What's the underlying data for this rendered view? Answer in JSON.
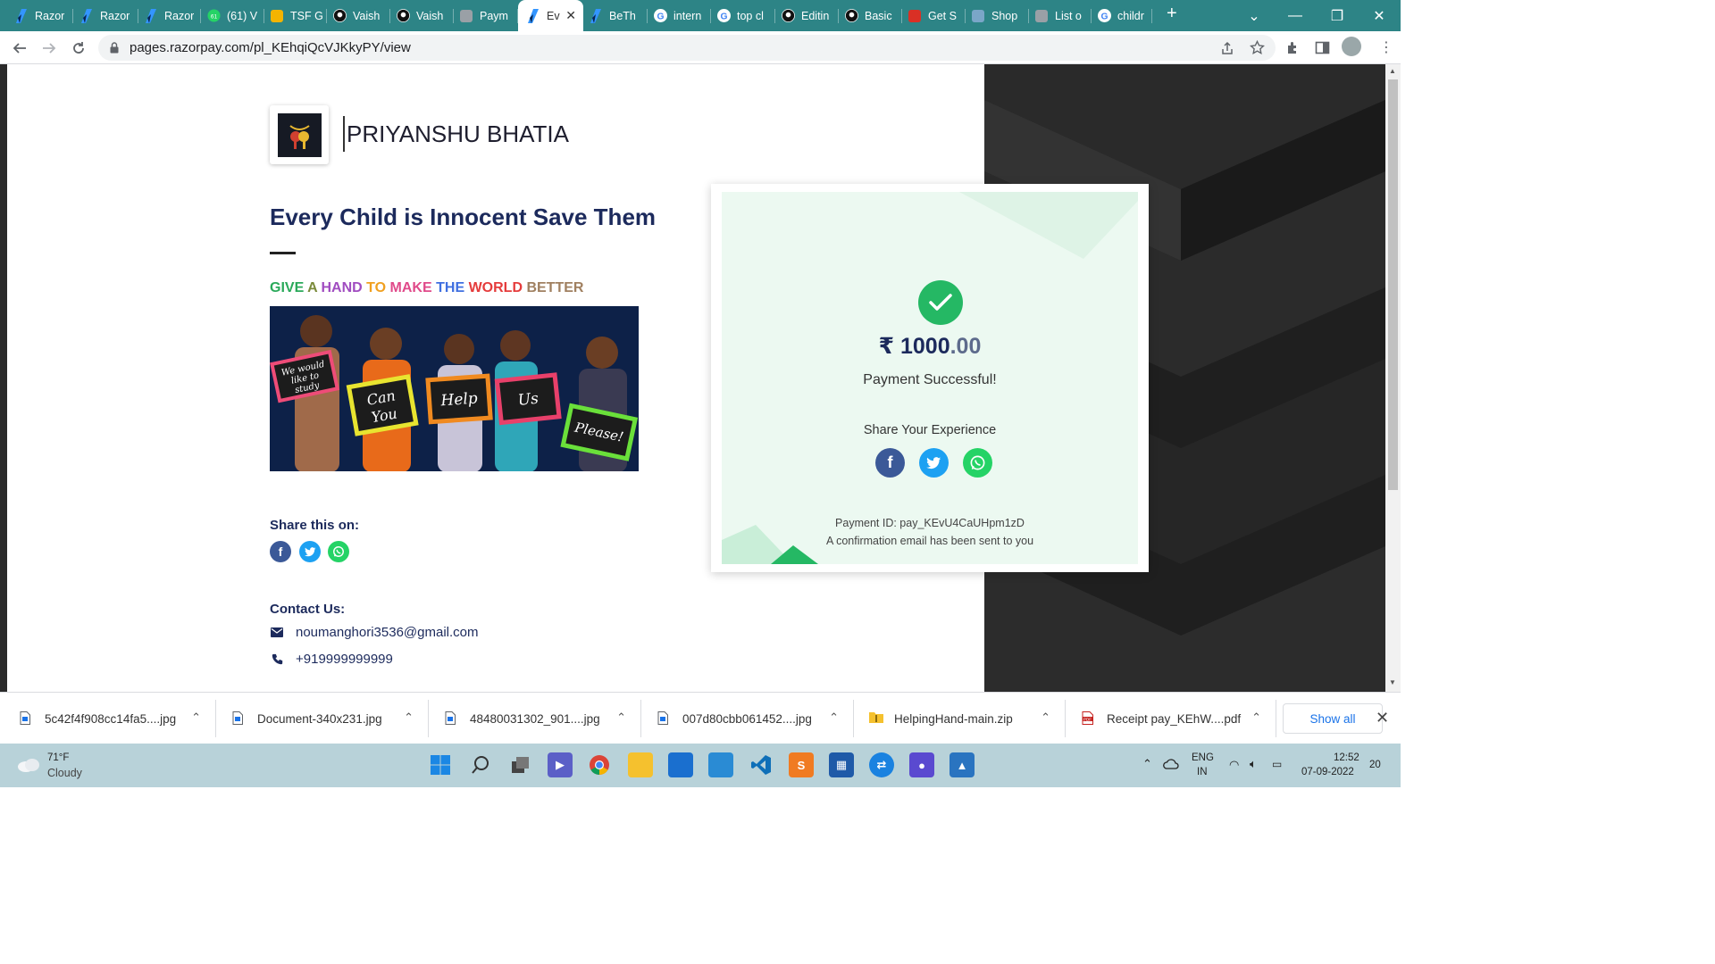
{
  "browser": {
    "tabs": [
      {
        "label": "Razor",
        "icon": "razorpay-icon"
      },
      {
        "label": "Razor",
        "icon": "razorpay-icon"
      },
      {
        "label": "Razor",
        "icon": "razorpay-icon"
      },
      {
        "label": "(61) V",
        "icon": "whatsapp-icon"
      },
      {
        "label": "TSF G",
        "icon": "slides-icon"
      },
      {
        "label": "Vaish",
        "icon": "github-icon"
      },
      {
        "label": "Vaish",
        "icon": "github-icon"
      },
      {
        "label": "Paym",
        "icon": "page-icon"
      },
      {
        "label": "Ev",
        "icon": "razorpay-icon",
        "active": true
      },
      {
        "label": "BeTh",
        "icon": "razorpay-icon"
      },
      {
        "label": "intern",
        "icon": "google-icon"
      },
      {
        "label": "top cl",
        "icon": "google-icon"
      },
      {
        "label": "Editin",
        "icon": "github-icon"
      },
      {
        "label": "Basic",
        "icon": "github-icon"
      },
      {
        "label": "Get S",
        "icon": "getsnippet-icon"
      },
      {
        "label": "Shop",
        "icon": "shop-icon"
      },
      {
        "label": "List o",
        "icon": "page-icon"
      },
      {
        "label": "childr",
        "icon": "google-icon"
      }
    ],
    "new_tab": "+",
    "url": "pages.razorpay.com/pl_KEhqiQcVJKkyPY/view"
  },
  "page": {
    "merchant_name": "PRIYANSHU BHATIA",
    "headline": "Every Child is Innocent Save Them",
    "tagline": [
      {
        "text": "GIVE",
        "color": "#2aa95a"
      },
      {
        "text": "A",
        "color": "#7a8a3a"
      },
      {
        "text": "HAND",
        "color": "#a04cc0"
      },
      {
        "text": "TO",
        "color": "#f0a020"
      },
      {
        "text": "MAKE",
        "color": "#e04a8a"
      },
      {
        "text": "THE",
        "color": "#3f6fe0"
      },
      {
        "text": "WORLD",
        "color": "#e53c3c"
      },
      {
        "text": "BETTER",
        "color": "#a08060"
      }
    ],
    "photo_signs": [
      "We would like to study",
      "Can You",
      "Help",
      "Us",
      "Please!"
    ],
    "share_label": "Share this on:",
    "contact_label": "Contact Us:",
    "email": "noumanghori3536@gmail.com",
    "phone": "+919999999999"
  },
  "payment": {
    "currency_symbol": "₹",
    "amount_whole": "1000",
    "amount_decimal": ".00",
    "status": "Payment Successful!",
    "share_label": "Share Your Experience",
    "payment_id": "Payment ID: pay_KEvU4CaUHpm1zD",
    "confirmation": "A confirmation email has been sent to you"
  },
  "downloads": {
    "items": [
      {
        "name": "5c42f4f908cc14fa5....jpg",
        "type": "image"
      },
      {
        "name": "Document-340x231.jpg",
        "type": "image"
      },
      {
        "name": "48480031302_901....jpg",
        "type": "image"
      },
      {
        "name": "007d80cbb061452....jpg",
        "type": "image"
      },
      {
        "name": "HelpingHand-main.zip",
        "type": "zip"
      },
      {
        "name": "Receipt pay_KEhW....pdf",
        "type": "pdf"
      }
    ],
    "show_all": "Show all"
  },
  "taskbar": {
    "weather_temp": "71°F",
    "weather_desc": "Cloudy",
    "lang_top": "ENG",
    "lang_bottom": "IN",
    "time": "12:52",
    "date": "07-09-2022",
    "notifications": "20"
  },
  "colors": {
    "tabstrip": "#2d8486",
    "success_green": "#25b864",
    "navy": "#1c2a5c",
    "facebook": "#3b5998",
    "twitter": "#1da1f2",
    "whatsapp": "#25d366"
  }
}
